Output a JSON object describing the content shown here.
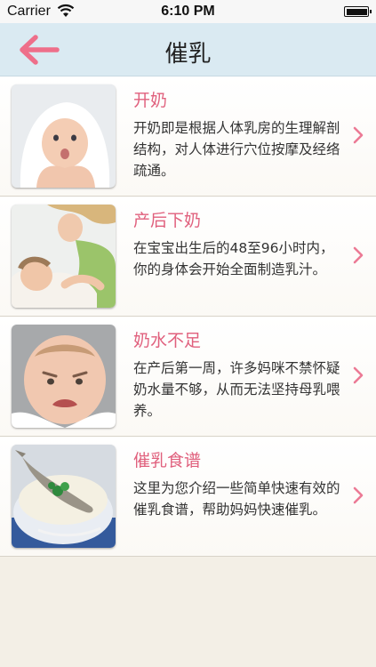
{
  "status_bar": {
    "carrier": "Carrier",
    "time": "6:10 PM"
  },
  "nav": {
    "title": "催乳",
    "back_icon": "arrow-left-icon",
    "accent_color": "#ee6f8a"
  },
  "items": [
    {
      "title": "开奶",
      "desc": "开奶即是根据人体乳房的生理解剖结构，对人体进行穴位按摩及经络疏通。"
    },
    {
      "title": "产后下奶",
      "desc": "在宝宝出生后的48至96小时内，你的身体会开始全面制造乳汁。"
    },
    {
      "title": "奶水不足",
      "desc": "在产后第一周，许多妈咪不禁怀疑奶水量不够，从而无法坚持母乳喂养。"
    },
    {
      "title": "催乳食谱",
      "desc": "这里为您介绍一些简单快速有效的催乳食谱，帮助妈妈快速催乳。"
    }
  ]
}
